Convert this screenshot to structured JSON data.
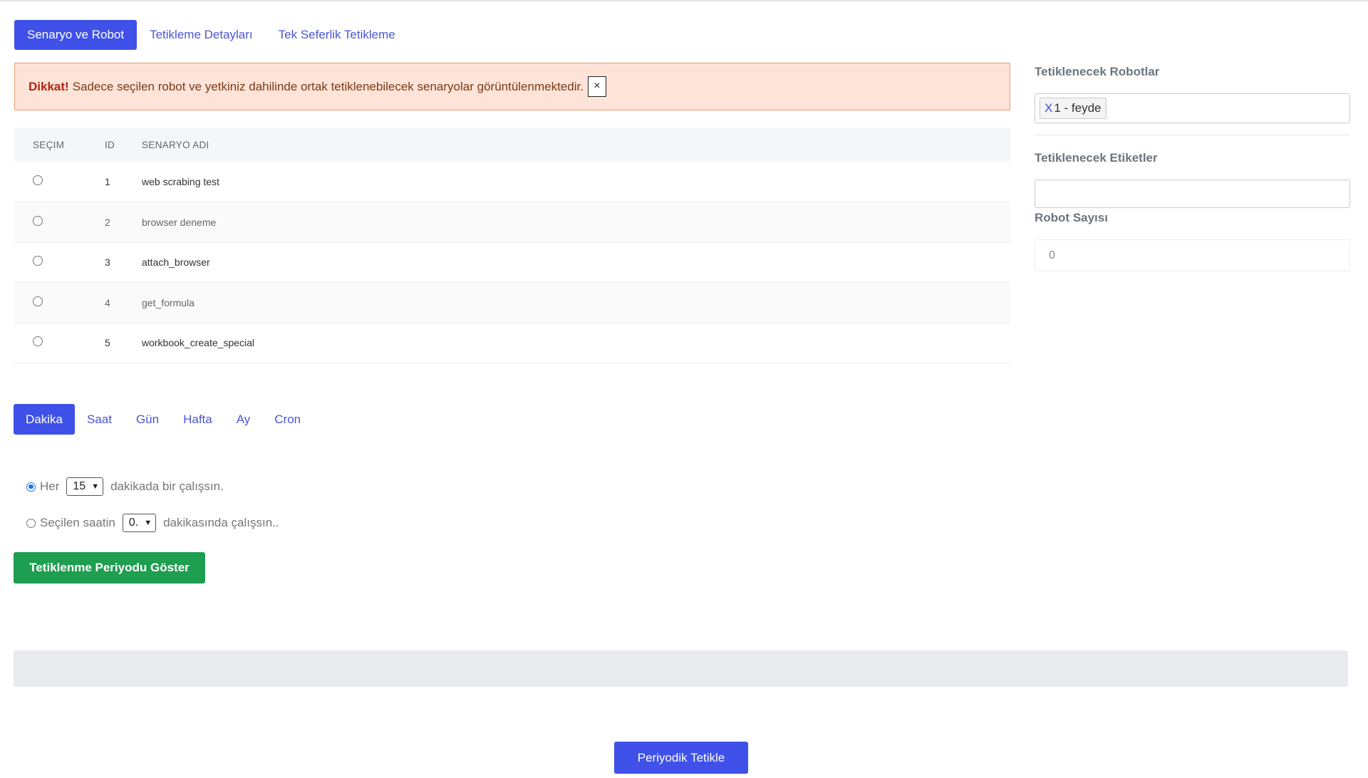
{
  "top_tabs": [
    {
      "label": "Senaryo ve Robot",
      "active": true
    },
    {
      "label": "Tetikleme Detayları",
      "active": false
    },
    {
      "label": "Tek Seferlik Tetikleme",
      "active": false
    }
  ],
  "alert": {
    "strong": "Dikkat!",
    "message": "Sadece seçilen robot ve yetkiniz dahilinde ortak tetiklenebilecek senaryolar görüntülenmektedir.",
    "close_label": "×"
  },
  "table": {
    "headers": {
      "select": "SEÇIM",
      "id": "ID",
      "name": "SENARYO ADI"
    },
    "rows": [
      {
        "id": "1",
        "name": "web scrabing test"
      },
      {
        "id": "2",
        "name": "browser deneme"
      },
      {
        "id": "3",
        "name": "attach_browser"
      },
      {
        "id": "4",
        "name": "get_formula"
      },
      {
        "id": "5",
        "name": "workbook_create_special"
      }
    ]
  },
  "right_panel": {
    "robots_label": "Tetiklenecek Robotlar",
    "robot_tag": {
      "remove": "X",
      "label": "1 - feyde"
    },
    "tags_label": "Tetiklenecek Etiketler",
    "tags_value": "",
    "robot_count_label": "Robot Sayısı",
    "robot_count_value": "0"
  },
  "period_tabs": [
    {
      "label": "Dakika",
      "active": true
    },
    {
      "label": "Saat",
      "active": false
    },
    {
      "label": "Gün",
      "active": false
    },
    {
      "label": "Hafta",
      "active": false
    },
    {
      "label": "Ay",
      "active": false
    },
    {
      "label": "Cron",
      "active": false
    }
  ],
  "options": {
    "every": {
      "label": "Her",
      "value": "15",
      "suffix": "dakikada bir çalışsın.",
      "checked": true
    },
    "selected_hour": {
      "label": "Seçilen saatin",
      "value": "0.",
      "suffix": "dakikasında çalışsın..",
      "checked": false
    }
  },
  "buttons": {
    "show_period": "Tetiklenme Periyodu Göster",
    "periodic_trigger": "Periyodik Tetikle"
  },
  "colors": {
    "primary": "#3f51e8",
    "success": "#1e9e4f",
    "alert_bg": "#fde3d8",
    "alert_border": "#e9a06e"
  }
}
